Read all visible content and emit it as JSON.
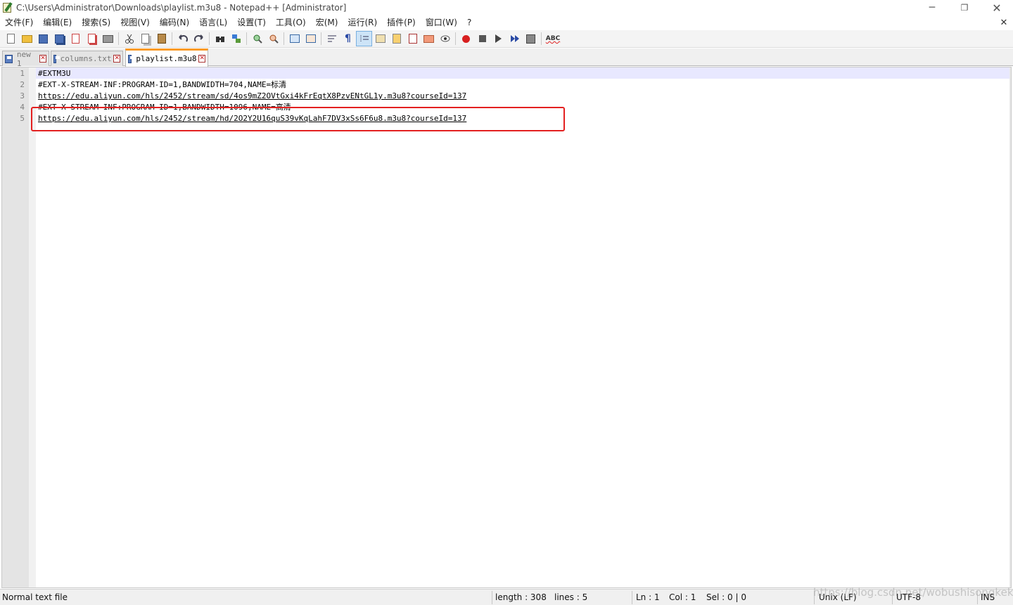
{
  "window": {
    "title": "C:\\Users\\Administrator\\Downloads\\playlist.m3u8 - Notepad++ [Administrator]",
    "minimize_glyph": "─",
    "maximize_glyph": "❐",
    "close_glyph": "✕"
  },
  "menu": {
    "items": [
      "文件(F)",
      "编辑(E)",
      "搜索(S)",
      "视图(V)",
      "编码(N)",
      "语言(L)",
      "设置(T)",
      "工具(O)",
      "宏(M)",
      "运行(R)",
      "插件(P)",
      "窗口(W)",
      "?"
    ],
    "close_glyph": "✕"
  },
  "toolbar": {
    "icons": [
      "new-file-icon",
      "open-file-icon",
      "save-icon",
      "save-all-icon",
      "close-icon",
      "close-all-icon",
      "print-icon",
      "cut-icon",
      "copy-icon",
      "paste-icon",
      "undo-icon",
      "redo-icon",
      "find-icon",
      "replace-icon",
      "zoom-in-icon",
      "zoom-out-icon",
      "sync-vertical-icon",
      "sync-horizontal-icon",
      "word-wrap-icon",
      "show-all-chars-icon",
      "indent-guide-icon",
      "doc-map-icon",
      "function-list-icon",
      "folder-as-workspace-icon",
      "doc-list-icon",
      "monitoring-icon",
      "record-macro-icon",
      "stop-macro-icon",
      "play-macro-icon",
      "run-macro-multiple-icon",
      "save-macro-icon",
      "spell-check-icon"
    ],
    "spell_label": "ABC",
    "pilcrow": "¶"
  },
  "tabs": [
    {
      "label": "new 1",
      "close_glyph": "✕"
    },
    {
      "label": "columns.txt",
      "close_glyph": "✕"
    },
    {
      "label": "playlist.m3u8",
      "close_glyph": "✕"
    }
  ],
  "editor": {
    "line_numbers": [
      "1",
      "2",
      "3",
      "4",
      "5"
    ],
    "lines": [
      "#EXTM3U",
      "#EXT-X-STREAM-INF:PROGRAM-ID=1,BANDWIDTH=704,NAME=标清",
      "https://edu.aliyun.com/hls/2452/stream/sd/4os9mZ2OVtGxi4kFrEqtX8PzvENtGL1y.m3u8?courseId=137",
      "#EXT-X-STREAM-INF:PROGRAM-ID=1,BANDWIDTH=1096,NAME=高清",
      "https://edu.aliyun.com/hls/2452/stream/hd/2O2Y2U16quS39vKqLahF7DV3xSs6F6u8.m3u8?courseId=137"
    ]
  },
  "statusbar": {
    "file_type": "Normal text file",
    "length": "length : 308",
    "lines": "lines : 5",
    "ln": "Ln : 1",
    "col": "Col : 1",
    "sel": "Sel : 0 | 0",
    "eol": "Unix (LF)",
    "encoding": "UTF-8",
    "mode": "INS"
  },
  "watermark": "https://blog.csdn.net/wobushisongkeke",
  "colors": {
    "active_tab_accent": "#fa9b28",
    "highlight_box": "#e32020",
    "current_line": "#e8e8ff"
  }
}
